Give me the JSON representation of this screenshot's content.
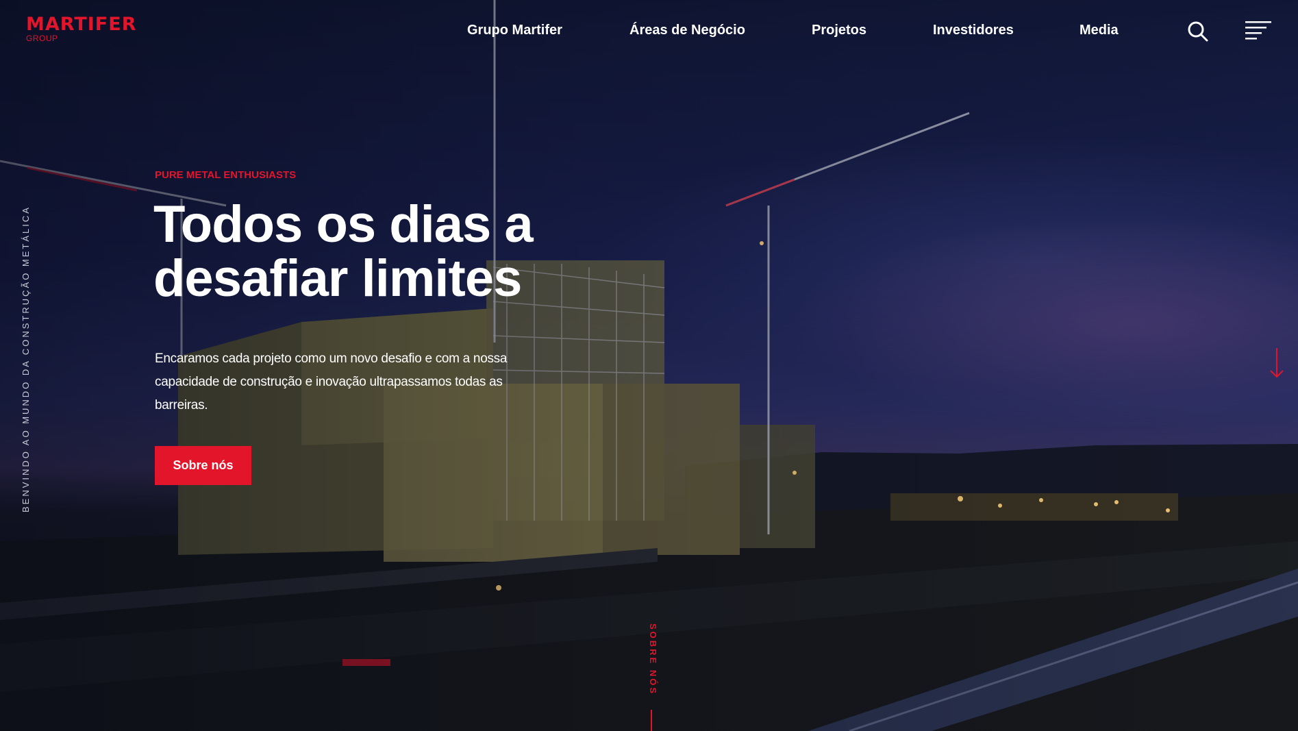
{
  "brand": {
    "name": "MARTIFER",
    "sub": "GROUP",
    "accent_color": "#e3152b"
  },
  "nav": {
    "items": [
      {
        "label": "Grupo Martifer"
      },
      {
        "label": "Áreas de Negócio"
      },
      {
        "label": "Projetos"
      },
      {
        "label": "Investidores"
      },
      {
        "label": "Media"
      }
    ],
    "search_icon": "search-icon",
    "menu_icon": "hamburger-menu-icon"
  },
  "hero": {
    "eyebrow": "PURE METAL ENTHUSIASTS",
    "title": "Todos os dias a desafiar limites",
    "lead": "Encaramos cada projeto como um novo desafio e com a nossa capacidade de construção e inovação ultrapassamos todas as barreiras.",
    "cta_label": "Sobre nós",
    "side_text": "BENVINDO AO MUNDO DA CONSTRUÇÃO METÁLICA",
    "section_marker": "SOBRE NÓS",
    "scroll_icon": "arrow-down-icon"
  }
}
